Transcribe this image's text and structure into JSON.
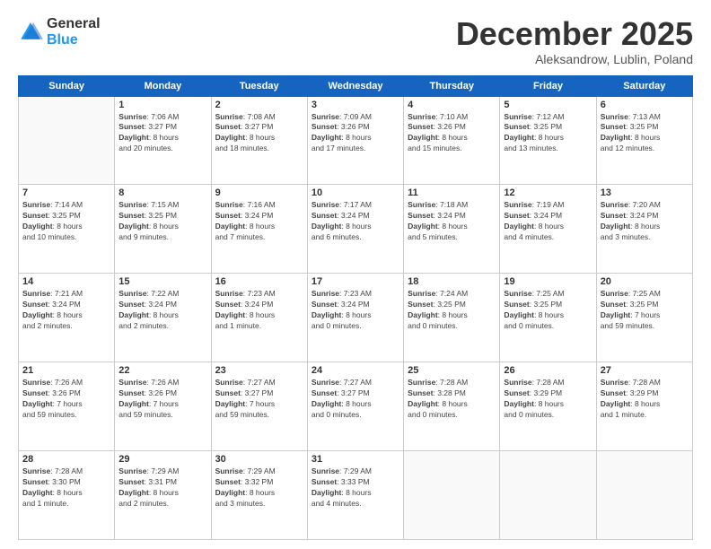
{
  "logo": {
    "general": "General",
    "blue": "Blue"
  },
  "header": {
    "month": "December 2025",
    "location": "Aleksandrow, Lublin, Poland"
  },
  "days": [
    "Sunday",
    "Monday",
    "Tuesday",
    "Wednesday",
    "Thursday",
    "Friday",
    "Saturday"
  ],
  "weeks": [
    [
      {
        "day": "",
        "info": ""
      },
      {
        "day": "1",
        "info": "Sunrise: 7:06 AM\nSunset: 3:27 PM\nDaylight: 8 hours\nand 20 minutes."
      },
      {
        "day": "2",
        "info": "Sunrise: 7:08 AM\nSunset: 3:27 PM\nDaylight: 8 hours\nand 18 minutes."
      },
      {
        "day": "3",
        "info": "Sunrise: 7:09 AM\nSunset: 3:26 PM\nDaylight: 8 hours\nand 17 minutes."
      },
      {
        "day": "4",
        "info": "Sunrise: 7:10 AM\nSunset: 3:26 PM\nDaylight: 8 hours\nand 15 minutes."
      },
      {
        "day": "5",
        "info": "Sunrise: 7:12 AM\nSunset: 3:25 PM\nDaylight: 8 hours\nand 13 minutes."
      },
      {
        "day": "6",
        "info": "Sunrise: 7:13 AM\nSunset: 3:25 PM\nDaylight: 8 hours\nand 12 minutes."
      }
    ],
    [
      {
        "day": "7",
        "info": "Sunrise: 7:14 AM\nSunset: 3:25 PM\nDaylight: 8 hours\nand 10 minutes."
      },
      {
        "day": "8",
        "info": "Sunrise: 7:15 AM\nSunset: 3:25 PM\nDaylight: 8 hours\nand 9 minutes."
      },
      {
        "day": "9",
        "info": "Sunrise: 7:16 AM\nSunset: 3:24 PM\nDaylight: 8 hours\nand 7 minutes."
      },
      {
        "day": "10",
        "info": "Sunrise: 7:17 AM\nSunset: 3:24 PM\nDaylight: 8 hours\nand 6 minutes."
      },
      {
        "day": "11",
        "info": "Sunrise: 7:18 AM\nSunset: 3:24 PM\nDaylight: 8 hours\nand 5 minutes."
      },
      {
        "day": "12",
        "info": "Sunrise: 7:19 AM\nSunset: 3:24 PM\nDaylight: 8 hours\nand 4 minutes."
      },
      {
        "day": "13",
        "info": "Sunrise: 7:20 AM\nSunset: 3:24 PM\nDaylight: 8 hours\nand 3 minutes."
      }
    ],
    [
      {
        "day": "14",
        "info": "Sunrise: 7:21 AM\nSunset: 3:24 PM\nDaylight: 8 hours\nand 2 minutes."
      },
      {
        "day": "15",
        "info": "Sunrise: 7:22 AM\nSunset: 3:24 PM\nDaylight: 8 hours\nand 2 minutes."
      },
      {
        "day": "16",
        "info": "Sunrise: 7:23 AM\nSunset: 3:24 PM\nDaylight: 8 hours\nand 1 minute."
      },
      {
        "day": "17",
        "info": "Sunrise: 7:23 AM\nSunset: 3:24 PM\nDaylight: 8 hours\nand 0 minutes."
      },
      {
        "day": "18",
        "info": "Sunrise: 7:24 AM\nSunset: 3:25 PM\nDaylight: 8 hours\nand 0 minutes."
      },
      {
        "day": "19",
        "info": "Sunrise: 7:25 AM\nSunset: 3:25 PM\nDaylight: 8 hours\nand 0 minutes."
      },
      {
        "day": "20",
        "info": "Sunrise: 7:25 AM\nSunset: 3:25 PM\nDaylight: 7 hours\nand 59 minutes."
      }
    ],
    [
      {
        "day": "21",
        "info": "Sunrise: 7:26 AM\nSunset: 3:26 PM\nDaylight: 7 hours\nand 59 minutes."
      },
      {
        "day": "22",
        "info": "Sunrise: 7:26 AM\nSunset: 3:26 PM\nDaylight: 7 hours\nand 59 minutes."
      },
      {
        "day": "23",
        "info": "Sunrise: 7:27 AM\nSunset: 3:27 PM\nDaylight: 7 hours\nand 59 minutes."
      },
      {
        "day": "24",
        "info": "Sunrise: 7:27 AM\nSunset: 3:27 PM\nDaylight: 8 hours\nand 0 minutes."
      },
      {
        "day": "25",
        "info": "Sunrise: 7:28 AM\nSunset: 3:28 PM\nDaylight: 8 hours\nand 0 minutes."
      },
      {
        "day": "26",
        "info": "Sunrise: 7:28 AM\nSunset: 3:29 PM\nDaylight: 8 hours\nand 0 minutes."
      },
      {
        "day": "27",
        "info": "Sunrise: 7:28 AM\nSunset: 3:29 PM\nDaylight: 8 hours\nand 1 minute."
      }
    ],
    [
      {
        "day": "28",
        "info": "Sunrise: 7:28 AM\nSunset: 3:30 PM\nDaylight: 8 hours\nand 1 minute."
      },
      {
        "day": "29",
        "info": "Sunrise: 7:29 AM\nSunset: 3:31 PM\nDaylight: 8 hours\nand 2 minutes."
      },
      {
        "day": "30",
        "info": "Sunrise: 7:29 AM\nSunset: 3:32 PM\nDaylight: 8 hours\nand 3 minutes."
      },
      {
        "day": "31",
        "info": "Sunrise: 7:29 AM\nSunset: 3:33 PM\nDaylight: 8 hours\nand 4 minutes."
      },
      {
        "day": "",
        "info": ""
      },
      {
        "day": "",
        "info": ""
      },
      {
        "day": "",
        "info": ""
      }
    ]
  ]
}
